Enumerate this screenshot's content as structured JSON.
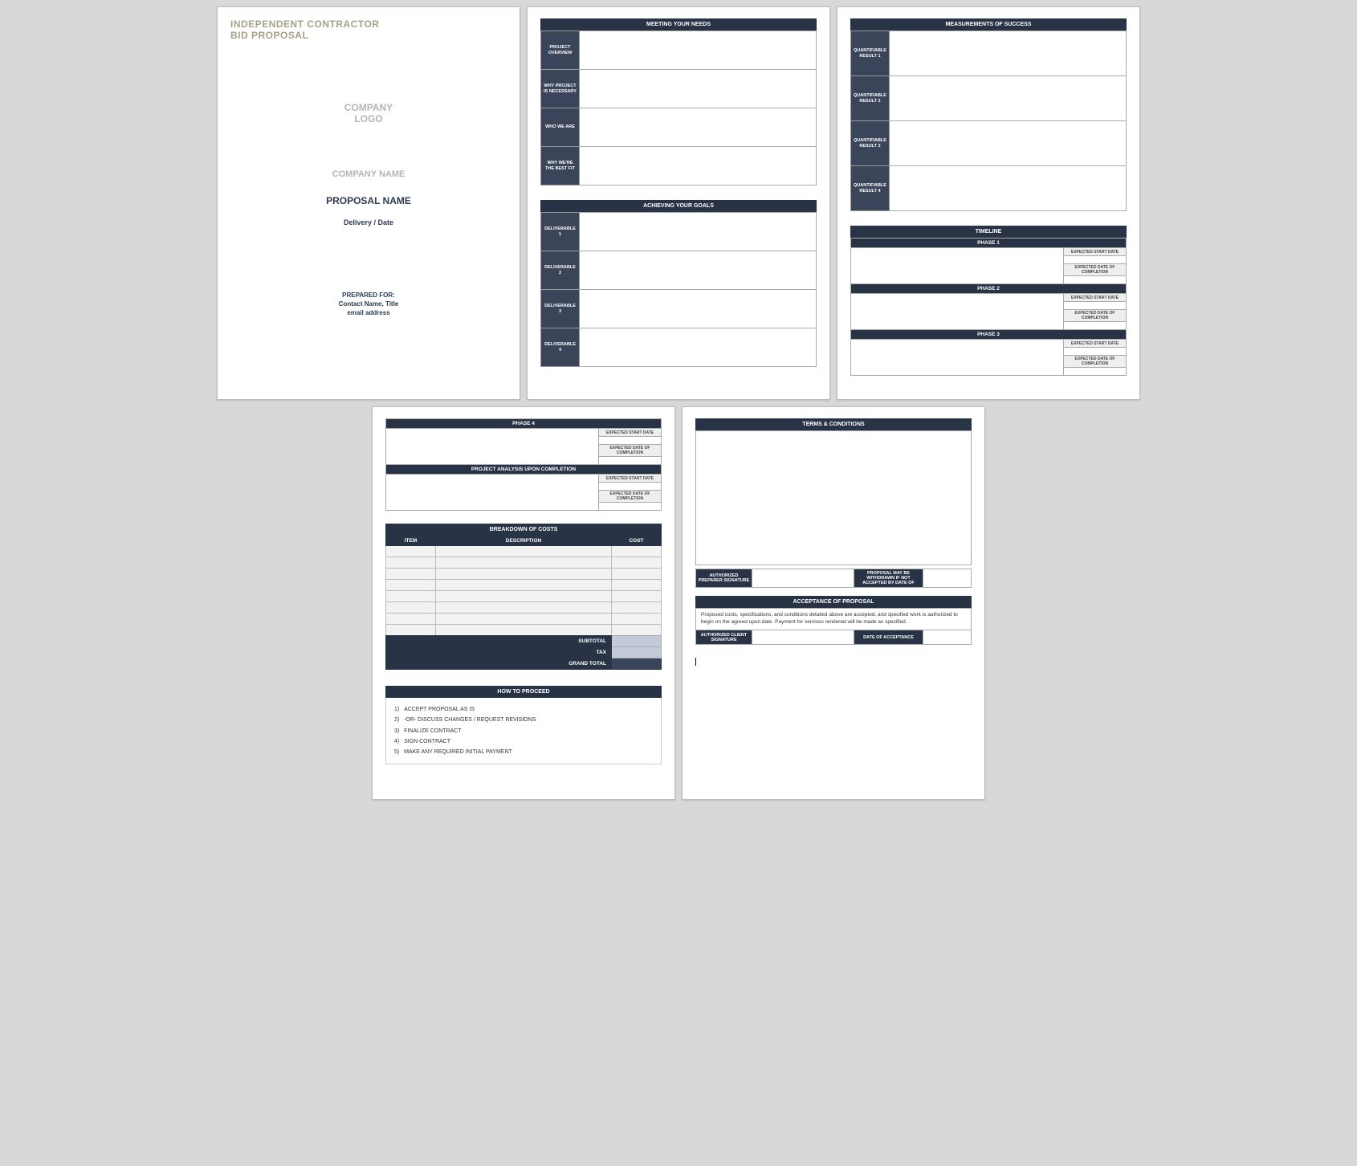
{
  "cover": {
    "doc_title_line1": "INDEPENDENT CONTRACTOR",
    "doc_title_line2": "BID PROPOSAL",
    "company_logo_line1": "COMPANY",
    "company_logo_line2": "LOGO",
    "company_name": "COMPANY NAME",
    "proposal_name": "PROPOSAL NAME",
    "delivery_date": "Delivery / Date",
    "prepared_for_label": "PREPARED FOR:",
    "prepared_for_contact": "Contact Name, Title",
    "prepared_for_email": "email address"
  },
  "page2": {
    "meeting_header": "MEETING YOUR NEEDS",
    "meeting_rows": [
      "PROJECT OVERVIEW",
      "WHY PROJECT IS NECESSARY",
      "WHO WE ARE",
      "WHY WE'RE THE BEST FIT"
    ],
    "goals_header": "ACHIEVING YOUR GOALS",
    "goals_rows": [
      "DELIVERABLE 1",
      "DELIVERABLE 2",
      "DELIVERABLE 3",
      "DELIVERABLE 4"
    ]
  },
  "page3": {
    "measure_header": "MEASUREMENTS OF SUCCESS",
    "measure_rows": [
      "QUANTIFIABLE RESULT 1",
      "QUANTIFIABLE RESULT 2",
      "QUANTIFIABLE RESULT 3",
      "QUANTIFIABLE RESULT 4"
    ],
    "timeline_header": "TIMELINE",
    "phases": [
      "PHASE 1",
      "PHASE 2",
      "PHASE 3"
    ],
    "expected_start": "EXPECTED START DATE",
    "expected_completion": "EXPECTED DATE OF COMPLETION"
  },
  "page4": {
    "phase4": "PHASE 4",
    "expected_start": "EXPECTED START DATE",
    "expected_completion": "EXPECTED DATE OF COMPLETION",
    "analysis_header": "PROJECT ANALYSIS UPON COMPLETION",
    "costs_header": "BREAKDOWN OF COSTS",
    "cost_cols": [
      "ITEM",
      "DESCRIPTION",
      "COST"
    ],
    "subtotal": "SUBTOTAL",
    "tax": "TAX",
    "grand_total": "GRAND TOTAL",
    "how_to_proceed_header": "HOW TO PROCEED",
    "steps": [
      "ACCEPT PROPOSAL AS IS",
      "-OR- DISCUSS CHANGES / REQUEST REVISIONS",
      "FINALIZE CONTRACT",
      "SIGN CONTRACT",
      "MAKE ANY REQUIRED INITIAL PAYMENT"
    ]
  },
  "page5": {
    "terms_header": "TERMS & CONDITIONS",
    "auth_preparer": "AUTHORIZED PREPARER SIGNATURE",
    "withdraw": "PROPOSAL MAY BE WITHDRAWN IF NOT ACCEPTED BY DATE OF",
    "acceptance_header": "ACCEPTANCE OF PROPOSAL",
    "acceptance_text": "Proposed costs, specifications, and conditions detailed above are accepted, and specified work is authorized to begin on the agreed upon date.  Payment for services rendered will be made as specified.",
    "auth_client": "AUTHORIZED CLIENT SIGNATURE",
    "date_acceptance": "DATE OF ACCEPTANCE"
  }
}
